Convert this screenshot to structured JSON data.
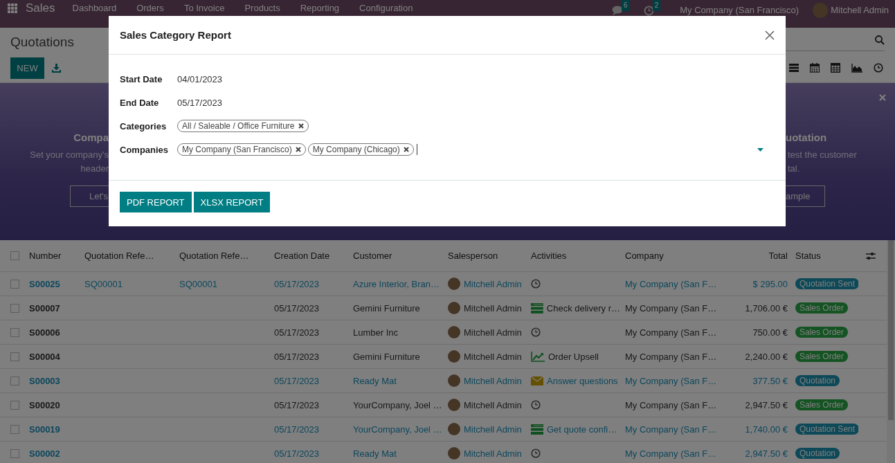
{
  "navbar": {
    "app": "Sales",
    "menu": [
      "Dashboard",
      "Orders",
      "To Invoice",
      "Products",
      "Reporting",
      "Configuration"
    ],
    "messages_count": "6",
    "activities_count": "2",
    "company": "My Company (San Francisco)",
    "user": "Mitchell Admin"
  },
  "control_panel": {
    "title": "Quotations",
    "new_button": "NEW",
    "views": [
      {
        "kind": "list"
      },
      {
        "kind": "calendar"
      },
      {
        "kind": "pivot"
      },
      {
        "kind": "graph"
      },
      {
        "kind": "activity"
      }
    ]
  },
  "banner": {
    "left": {
      "title": "Compa",
      "lines": [
        "Set your company's",
        "header"
      ],
      "button": "Let's"
    },
    "right": {
      "title": "uotation",
      "lines": [
        "test the customer",
        "tal."
      ],
      "button": "ample"
    }
  },
  "dialog": {
    "title": "Sales Category Report",
    "fields": [
      {
        "label": "Start Date",
        "kind": "date",
        "value": "04/01/2023"
      },
      {
        "label": "End Date",
        "kind": "date",
        "value": "05/17/2023"
      },
      {
        "label": "Categories",
        "kind": "tags",
        "tags": [
          "All / Saleable / Office Furniture"
        ],
        "focused": false
      },
      {
        "label": "Companies",
        "kind": "tags",
        "tags": [
          "My Company (San Francisco)",
          "My Company (Chicago)"
        ],
        "focused": true
      }
    ],
    "buttons": [
      "PDF REPORT",
      "XLSX REPORT"
    ]
  },
  "table": {
    "all_checked": false,
    "columns": [
      "Number",
      "Quotation Refe…",
      "Quotation Refe…",
      "Creation Date",
      "Customer",
      "Salesperson",
      "Activities",
      "Company",
      "Total",
      "Status"
    ],
    "rows": [
      {
        "checked": false,
        "number": "S00025",
        "quotation_ref_1": "SQ00001",
        "quotation_ref_2": "SQ00001",
        "creation_date": "05/17/2023",
        "customer": "Azure Interior, Bran…",
        "salesperson": "Mitchell Admin",
        "activity": {
          "kind": "clock"
        },
        "company": "My Company (San F…",
        "total": "$ 295.00",
        "status": {
          "kind": "quotation_sent",
          "label": "Quotation Sent"
        }
      },
      {
        "checked": false,
        "number": "S00007",
        "creation_date": "05/17/2023",
        "customer": "Gemini Furniture",
        "salesperson": "Mitchell Admin",
        "activity": {
          "kind": "todo",
          "text": "Check delivery r…"
        },
        "company": "My Company (San F…",
        "total": "1,706.00 €",
        "status": {
          "kind": "sales_order",
          "label": "Sales Order"
        }
      },
      {
        "checked": false,
        "number": "S00006",
        "creation_date": "05/17/2023",
        "customer": "Lumber Inc",
        "salesperson": "Mitchell Admin",
        "activity": {
          "kind": "clock"
        },
        "company": "My Company (San F…",
        "total": "750.00 €",
        "status": {
          "kind": "sales_order",
          "label": "Sales Order"
        }
      },
      {
        "checked": false,
        "number": "S00004",
        "creation_date": "05/17/2023",
        "customer": "Gemini Furniture",
        "salesperson": "Mitchell Admin",
        "activity": {
          "kind": "upsell",
          "text": "Order Upsell"
        },
        "company": "My Company (San F…",
        "total": "2,240.00 €",
        "status": {
          "kind": "sales_order",
          "label": "Sales Order"
        }
      },
      {
        "checked": false,
        "number": "S00003",
        "creation_date": "05/17/2023",
        "customer": "Ready Mat",
        "salesperson": "Mitchell Admin",
        "activity": {
          "kind": "email",
          "text": "Answer questions"
        },
        "company": "My Company (San F…",
        "total": "377.50 €",
        "status": {
          "kind": "quotation",
          "label": "Quotation"
        }
      },
      {
        "checked": false,
        "number": "S00020",
        "creation_date": "05/17/2023",
        "customer": "YourCompany, Joel …",
        "salesperson": "Mitchell Admin",
        "activity": {
          "kind": "clock"
        },
        "company": "My Company (San F…",
        "total": "2,947.50 €",
        "status": {
          "kind": "sales_order",
          "label": "Sales Order"
        }
      },
      {
        "checked": false,
        "number": "S00019",
        "creation_date": "05/17/2023",
        "customer": "YourCompany, Joel …",
        "salesperson": "Mitchell Admin",
        "activity": {
          "kind": "todo",
          "text": "Get quote confi…"
        },
        "company": "My Company (San F…",
        "total": "1,740.00 €",
        "status": {
          "kind": "quotation_sent",
          "label": "Quotation Sent"
        }
      },
      {
        "checked": false,
        "number": "S00002",
        "creation_date": "05/17/2023",
        "customer": "Ready Mat",
        "salesperson": "Mitchell Admin",
        "activity": {
          "kind": "clock"
        },
        "company": "My Company (San F…",
        "total": "2,947.50 €",
        "status": {
          "kind": "quotation",
          "label": "Quotation"
        }
      }
    ]
  }
}
